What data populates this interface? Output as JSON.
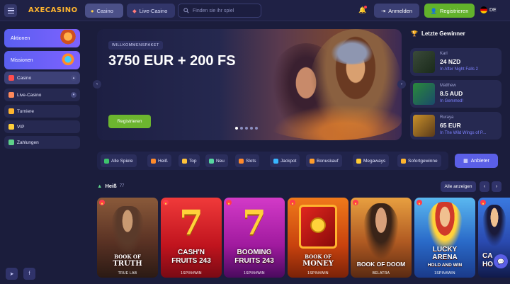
{
  "header": {
    "logo": "AXECASINO",
    "nav": [
      {
        "label": "Casino"
      },
      {
        "label": "Live-Casino"
      }
    ],
    "search_placeholder": "Finden sie ihr spiel",
    "login_label": "Anmelden",
    "register_label": "Registrieren",
    "language": "DE"
  },
  "sidebar": {
    "promos": [
      {
        "label": "Aktionen"
      },
      {
        "label": "Missionen"
      }
    ],
    "items": [
      {
        "label": "Casino",
        "icon": "casino-chips-icon"
      },
      {
        "label": "Live-Casino",
        "icon": "live-casino-icon"
      },
      {
        "label": "Turniere",
        "icon": "trophy-icon"
      },
      {
        "label": "VIP",
        "icon": "crown-icon"
      },
      {
        "label": "Zahlungen",
        "icon": "payment-icon"
      }
    ],
    "social": [
      "telegram-icon",
      "facebook-icon"
    ]
  },
  "hero": {
    "badge": "WILLKOMMENSPAKET",
    "title": "3750 EUR + 200 FS",
    "button": "Registrieren",
    "slides": 5,
    "active_slide": 1
  },
  "winners": {
    "title": "Letzte Gewinner",
    "list": [
      {
        "name": "Karl",
        "amount": "24 NZD",
        "game": "In After Night Falls 2"
      },
      {
        "name": "Matthew",
        "amount": "8.5 AUD",
        "game": "In Gemmed!"
      },
      {
        "name": "Ruraya",
        "amount": "65 EUR",
        "game": "In The Wild Wings of P..."
      }
    ]
  },
  "categories": [
    {
      "label": "Alle Spiele",
      "color": "#3ec46d"
    },
    {
      "label": "Heiß",
      "color": "#ff8a2b"
    },
    {
      "label": "Top",
      "color": "#ffc23a"
    },
    {
      "label": "Neu",
      "color": "#57d6a0"
    },
    {
      "label": "Slots",
      "color": "#ff8a2b"
    },
    {
      "label": "Jackpot",
      "color": "#38b6ff"
    },
    {
      "label": "Bonuskauf",
      "color": "#ff9d2b"
    },
    {
      "label": "Megaways",
      "color": "#ffcc33"
    },
    {
      "label": "Sofortgewinne",
      "color": "#ffb52e"
    }
  ],
  "providers_button": "Anbieter",
  "section": {
    "title": "Heiß",
    "count": "77",
    "show_all": "Alle anzeigen"
  },
  "games": [
    {
      "title_1": "BOOK OF",
      "title_2": "TRUTH",
      "provider": "TRUE LAB",
      "colors": [
        "#6a3a2a",
        "#2b1a14"
      ]
    },
    {
      "title_1": "CASH'N",
      "title_2": "FRUITS 243",
      "provider": "1SPIN4WIN",
      "colors": [
        "#e0262e",
        "#7a0a14"
      ]
    },
    {
      "title_1": "BOOMING",
      "title_2": "FRUITS 243",
      "provider": "1SPIN4WIN",
      "colors": [
        "#b01ea8",
        "#4a0a5e"
      ]
    },
    {
      "title_1": "BOOK OF",
      "title_2": "MONEY",
      "provider": "1SPIN4WIN",
      "colors": [
        "#e06a1a",
        "#7a2208"
      ]
    },
    {
      "title_1": "",
      "title_2": "BOOK OF DOOM",
      "provider": "BELATRA",
      "colors": [
        "#d08a3a",
        "#5a2a12"
      ]
    },
    {
      "title_1": "LUCKY",
      "title_2": "ARENA",
      "title_3": "HOLD AND WIN",
      "provider": "1SPIN4WIN",
      "colors": [
        "#3aa0e6",
        "#1a3a8a"
      ]
    },
    {
      "title_1": "CA",
      "title_2": "HO",
      "provider": "",
      "colors": [
        "#2a5ad0",
        "#101a4a"
      ]
    }
  ]
}
